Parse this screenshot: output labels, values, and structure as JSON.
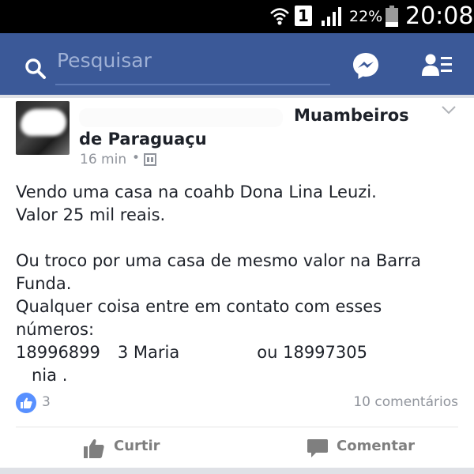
{
  "status_bar": {
    "sim_slot": "1",
    "battery": "22%",
    "time": "20:08",
    "icons": [
      "wifi-icon",
      "sim-icon",
      "signal-icon",
      "battery-icon"
    ]
  },
  "header": {
    "search_placeholder": "Pesquisar",
    "icons": [
      "search-icon",
      "messenger-icon",
      "friend-requests-icon"
    ],
    "brand_color": "#3b5998"
  },
  "post": {
    "group_name_line1": "Muambeiros",
    "group_name_line2": "de Paraguaçu",
    "time": "16 min",
    "separator": "•",
    "lines": [
      "Vendo uma casa na coahb Dona Lina Leuzi.",
      "Valor 25 mil reais.",
      "",
      "Ou troco por uma casa de mesmo valor na Barra",
      "Funda.",
      "Qualquer coisa entre em contato com esses",
      "números:"
    ],
    "phone_line": {
      "part1": "18996899",
      "part2": "3 Maria",
      "part3": "ou 18997305",
      "part4": ""
    },
    "last_line": "nia ."
  },
  "reactions": {
    "likes": "3",
    "comments": "10 comentários"
  },
  "actions": {
    "like_label": "Curtir",
    "comment_label": "Comentar"
  }
}
